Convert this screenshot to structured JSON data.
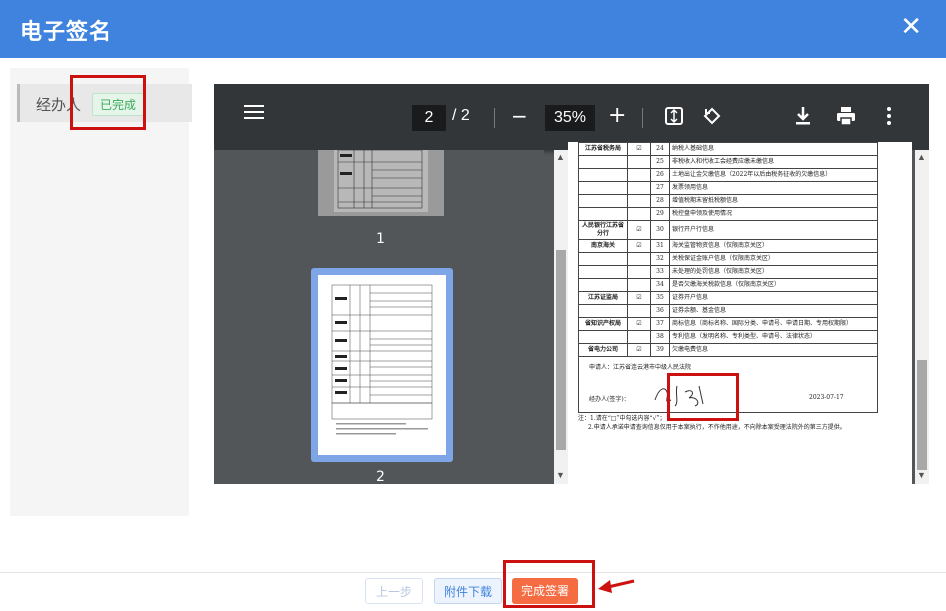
{
  "dialog": {
    "title": "电子签名",
    "close_icon": "close-icon"
  },
  "signers": [
    {
      "name": "经办人",
      "status": "已完成"
    }
  ],
  "viewer": {
    "current_page": "2",
    "page_separator": "/",
    "total_pages": "2",
    "zoom": "35%",
    "thumbnails": [
      {
        "label": "1"
      },
      {
        "label": "2"
      }
    ]
  },
  "document": {
    "rows": [
      {
        "org": "江苏省税务局",
        "chk": "☑",
        "num": "24",
        "text": "纳税人基础信息"
      },
      {
        "org": "",
        "chk": "",
        "num": "25",
        "text": "非税收入和代收工会经费应缴未缴信息"
      },
      {
        "org": "",
        "chk": "",
        "num": "26",
        "text": "土地出让金欠缴信息（2022年以后由税务征收的欠缴信息）"
      },
      {
        "org": "",
        "chk": "",
        "num": "27",
        "text": "发票领用信息"
      },
      {
        "org": "",
        "chk": "",
        "num": "28",
        "text": "增值税期末留抵税额信息"
      },
      {
        "org": "",
        "chk": "",
        "num": "29",
        "text": "税控盘申领及使用情况"
      },
      {
        "org": "人民银行江苏省分行",
        "chk": "☑",
        "num": "30",
        "text": "银行开户行信息"
      },
      {
        "org": "南京海关",
        "chk": "☑",
        "num": "31",
        "text": "海关监管物资信息（仅限南京关区）"
      },
      {
        "org": "",
        "chk": "",
        "num": "32",
        "text": "关税保证金账户信息（仅限南京关区）"
      },
      {
        "org": "",
        "chk": "",
        "num": "33",
        "text": "未处理的处罚信息（仅限南京关区）"
      },
      {
        "org": "",
        "chk": "",
        "num": "34",
        "text": "是否欠缴海关税款信息（仅限南京关区）"
      },
      {
        "org": "江苏证监局",
        "chk": "☑",
        "num": "35",
        "text": "证券开户信息"
      },
      {
        "org": "",
        "chk": "",
        "num": "36",
        "text": "证券余额、基金信息"
      },
      {
        "org": "省知识产权局",
        "chk": "☑",
        "num": "37",
        "text": "商标信息（商标名称、国际分类、申请号、申请日期、专用权期限）"
      },
      {
        "org": "",
        "chk": "",
        "num": "38",
        "text": "专利信息（发明名称、专利类型、申请号、法律状态）"
      },
      {
        "org": "省电力公司",
        "chk": "☑",
        "num": "39",
        "text": "欠缴电费信息"
      }
    ],
    "applicant": "申请人：江苏省连云港市中级人民法院",
    "signer_label": "经办人(签字)：",
    "signature": "孙庆",
    "date": "2023-07-17",
    "note1": "注：1.请在“□”中勾选内容“√”；",
    "note2": "2.申请人承诺申请查询信息仅用于本案执行，不作他用途，不向除本案受理法院外的第三方提供。"
  },
  "footer": {
    "prev_label": "上一步",
    "download_label": "附件下载",
    "done_label": "完成签署"
  },
  "colors": {
    "header": "#3f83de",
    "done_button": "#f56c42",
    "highlight": "#cc1111"
  }
}
